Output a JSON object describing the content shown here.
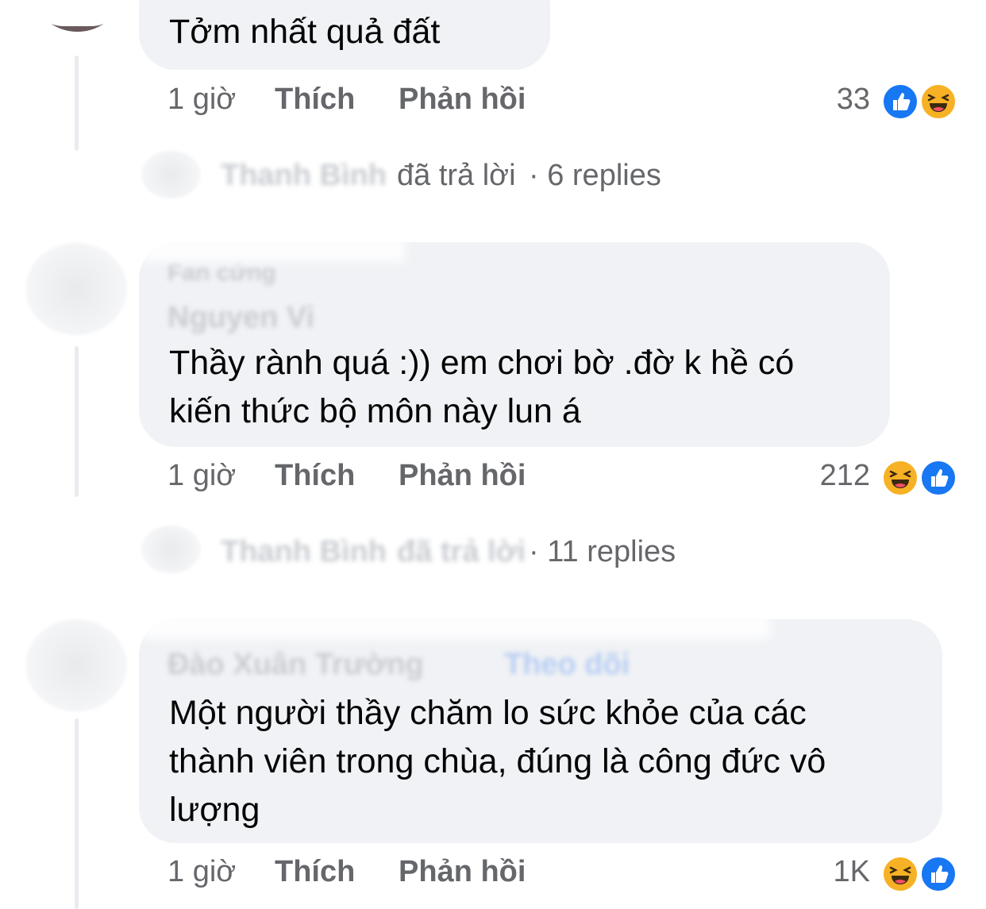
{
  "comments": [
    {
      "text": "Tởm nhất quả đất",
      "time": "1 giờ",
      "like_label": "Thích",
      "reply_label": "Phản hồi",
      "reaction_count": "33",
      "reactions": [
        "like-icon",
        "haha-icon"
      ],
      "replies": {
        "author": "Thanh Bình",
        "verb": "đã trả lời",
        "count": "· 6 replies"
      }
    },
    {
      "badge": "Fan cứng",
      "author": "Nguyen Vi",
      "text_line1": "Thầy rành quá :)) em chơi bờ .đờ k hề có",
      "text_line2": "kiến thức bộ môn này lun á",
      "time": "1 giờ",
      "like_label": "Thích",
      "reply_label": "Phản hồi",
      "reaction_count": "212",
      "reactions": [
        "haha-icon",
        "like-icon"
      ],
      "replies": {
        "author": "Thanh Bình",
        "verb": "đã trả lời",
        "count": "· 11 replies"
      }
    },
    {
      "author": "Đào Xuân Trường",
      "follow_label": "Theo dõi",
      "text_line1": "Một người thầy chăm lo sức khỏe của các",
      "text_line2": "thành viên trong chùa, đúng là công đức vô",
      "text_line3": "lượng",
      "time": "1 giờ",
      "like_label": "Thích",
      "reply_label": "Phản hồi",
      "reaction_count": "1K",
      "reactions": [
        "haha-icon",
        "like-icon"
      ]
    }
  ],
  "colors": {
    "bubble": "#f0f2f5",
    "meta_text": "#65676b",
    "like_blue": "#1877f2",
    "haha_yellow": "#f7b125"
  }
}
